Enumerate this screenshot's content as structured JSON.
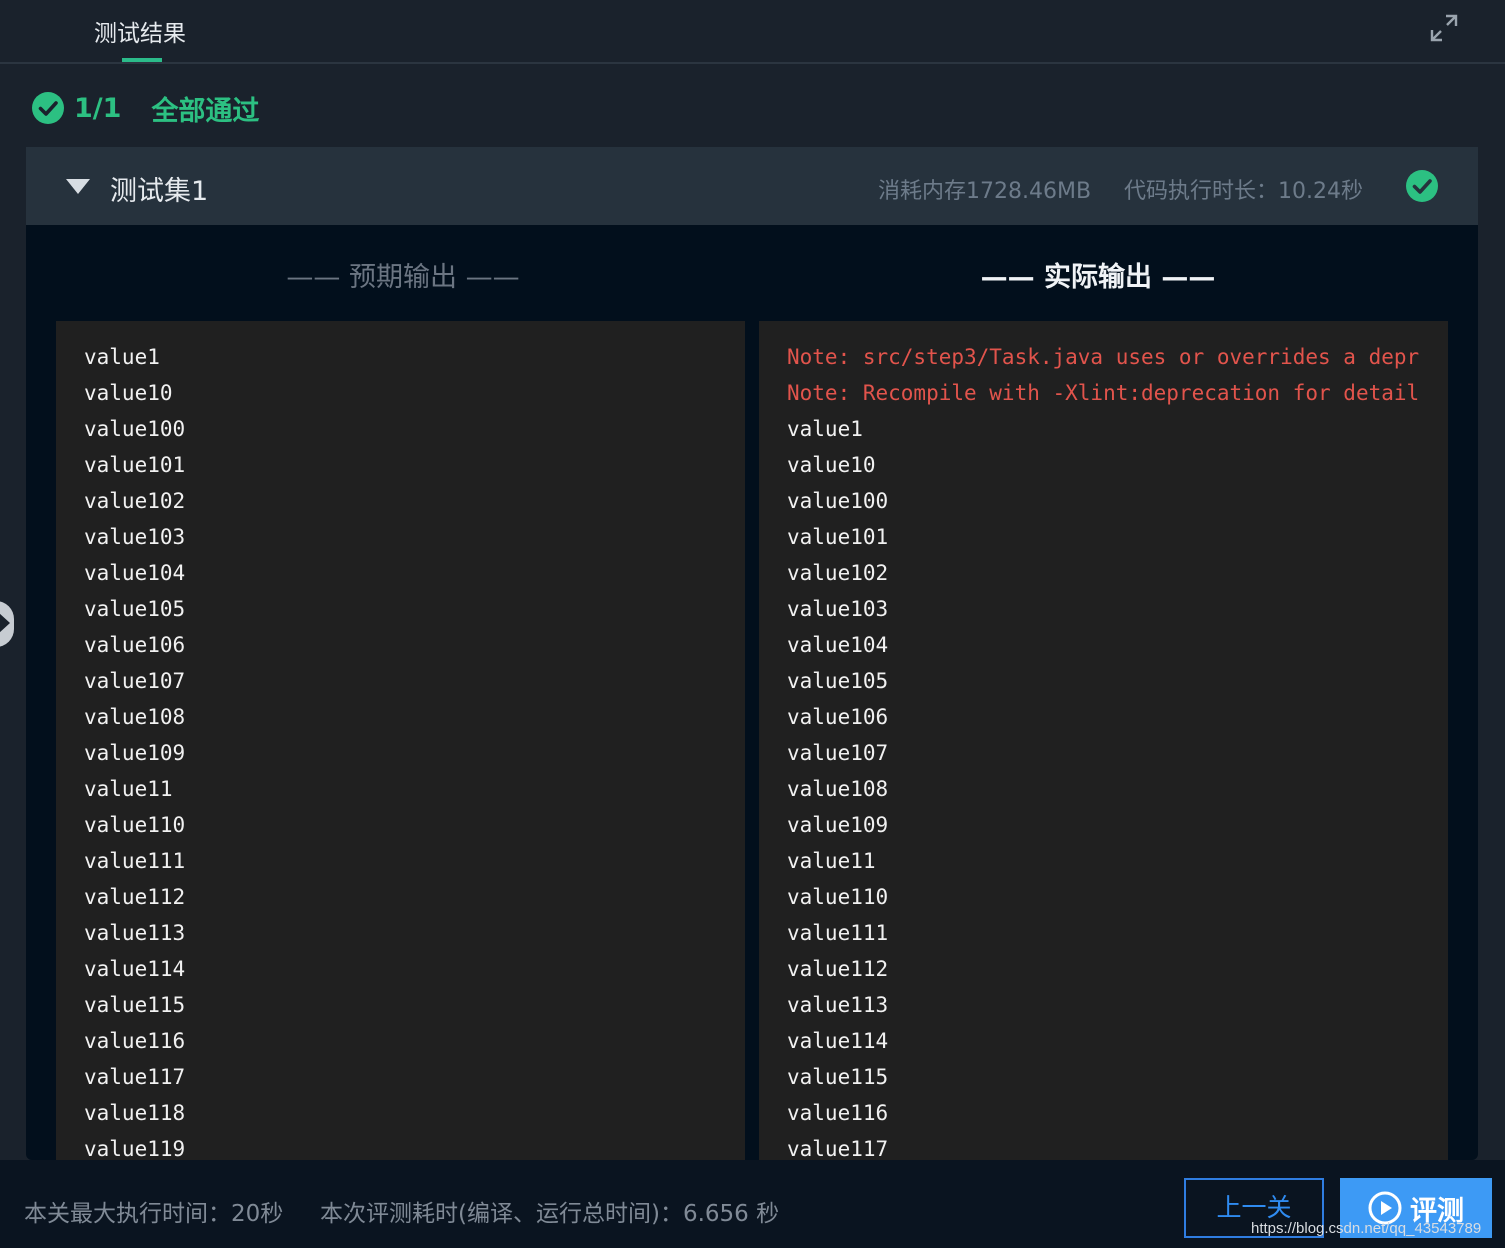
{
  "header": {
    "tab_label": "测试结果"
  },
  "summary": {
    "count": "1/1",
    "status": "全部通过"
  },
  "test_set": {
    "title": "测试集1",
    "memory": "消耗内存1728.46MB",
    "duration": "代码执行时长：10.24秒"
  },
  "expected": {
    "title": "—— 预期输出 ——",
    "lines": [
      "value1",
      "value10",
      "value100",
      "value101",
      "value102",
      "value103",
      "value104",
      "value105",
      "value106",
      "value107",
      "value108",
      "value109",
      "value11",
      "value110",
      "value111",
      "value112",
      "value113",
      "value114",
      "value115",
      "value116",
      "value117",
      "value118",
      "value119"
    ]
  },
  "actual": {
    "title": "—— 实际输出 ——",
    "warnings": [
      "Note: src/step3/Task.java uses or overrides a depr",
      "Note: Recompile with -Xlint:deprecation for detail"
    ],
    "lines": [
      "value1",
      "value10",
      "value100",
      "value101",
      "value102",
      "value103",
      "value104",
      "value105",
      "value106",
      "value107",
      "value108",
      "value109",
      "value11",
      "value110",
      "value111",
      "value112",
      "value113",
      "value114",
      "value115",
      "value116",
      "value117"
    ]
  },
  "footer": {
    "max_time": "本关最大执行时间：20秒",
    "run_time": "本次评测耗时(编译、运行总时间)：6.656 秒",
    "prev_label": "上一关",
    "eval_label": "评测"
  },
  "watermark": "https://blog.csdn.net/qq_43543789",
  "colors": {
    "success": "#2cc082",
    "warning_text": "#e2544c",
    "primary_button": "#3d9af5"
  },
  "icons": {
    "expand": "expand-icon",
    "pass": "check-circle-icon",
    "collapse": "caret-down-icon",
    "play": "play-circle-icon"
  }
}
